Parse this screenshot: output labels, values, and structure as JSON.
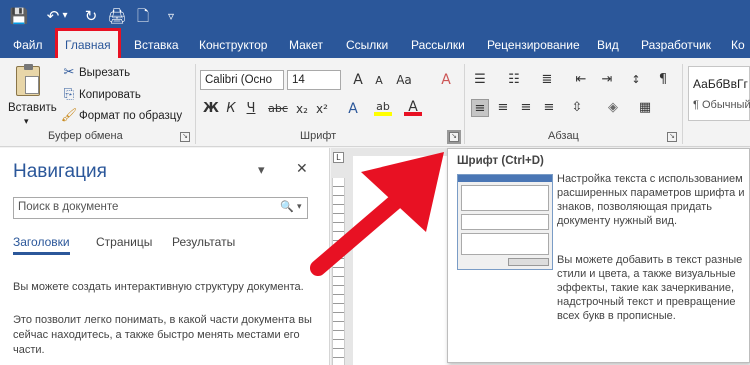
{
  "qat": {
    "save": "💾",
    "undo": "↶",
    "undo_arrow": "▾",
    "redo": "↻",
    "print": "🖨",
    "new": "🗋",
    "customize": "▿"
  },
  "tabs": [
    "Файл",
    "Главная",
    "Вставка",
    "Конструктор",
    "Макет",
    "Ссылки",
    "Рассылки",
    "Рецензирование",
    "Вид",
    "Разработчик",
    "Ко"
  ],
  "clipboard": {
    "paste": "Вставить",
    "paste_arrow": "▾",
    "cut": "Вырезать",
    "copy": "Копировать",
    "format_painter": "Формат по образцу",
    "group": "Буфер обмена"
  },
  "font": {
    "name": "Calibri (Осно",
    "size": "14",
    "grow": "A",
    "shrink": "A",
    "case": "Aa",
    "clear": "A",
    "bold": "Ж",
    "italic": "К",
    "underline": "Ч",
    "strike": "abc",
    "sub": "x₂",
    "sup": "x²",
    "effects": "A",
    "highlight": "ab",
    "color": "A",
    "group": "Шрифт"
  },
  "paragraph": {
    "group": "Абзац",
    "pilcrow": "¶"
  },
  "styles": {
    "sample": "АаБбВвГг",
    "name": "¶ Обычный"
  },
  "nav": {
    "title": "Навигация",
    "close": "✕",
    "dropdown": "▾",
    "search_placeholder": "Поиск в документе",
    "search_icon": "🔍",
    "search_arrow": "▾",
    "tabs": [
      "Заголовки",
      "Страницы",
      "Результаты"
    ],
    "text1": "Вы можете создать интерактивную структуру документа.",
    "text2": "Это позволит легко понимать, в какой части документа вы сейчас находитесь, а также быстро менять местами его части."
  },
  "ruler_mark": "L",
  "tooltip": {
    "title": "Шрифт (Ctrl+D)",
    "desc1": "Настройка текста с использованием расширенных параметров шрифта и знаков, позволяющая придать документу нужный вид.",
    "desc2": "Вы можете добавить в текст разные стили и цвета, а также визуальные эффекты, такие как зачеркивание, надстрочный текст и превращение всех букв в прописные."
  },
  "colors": {
    "title_bar": "#2b579a",
    "highlight_tab_border": "#e81123",
    "arrow": "#e81123",
    "highlight_yellow": "#ffff00",
    "font_red": "#e81123",
    "nav_accent": "#2b579a"
  }
}
